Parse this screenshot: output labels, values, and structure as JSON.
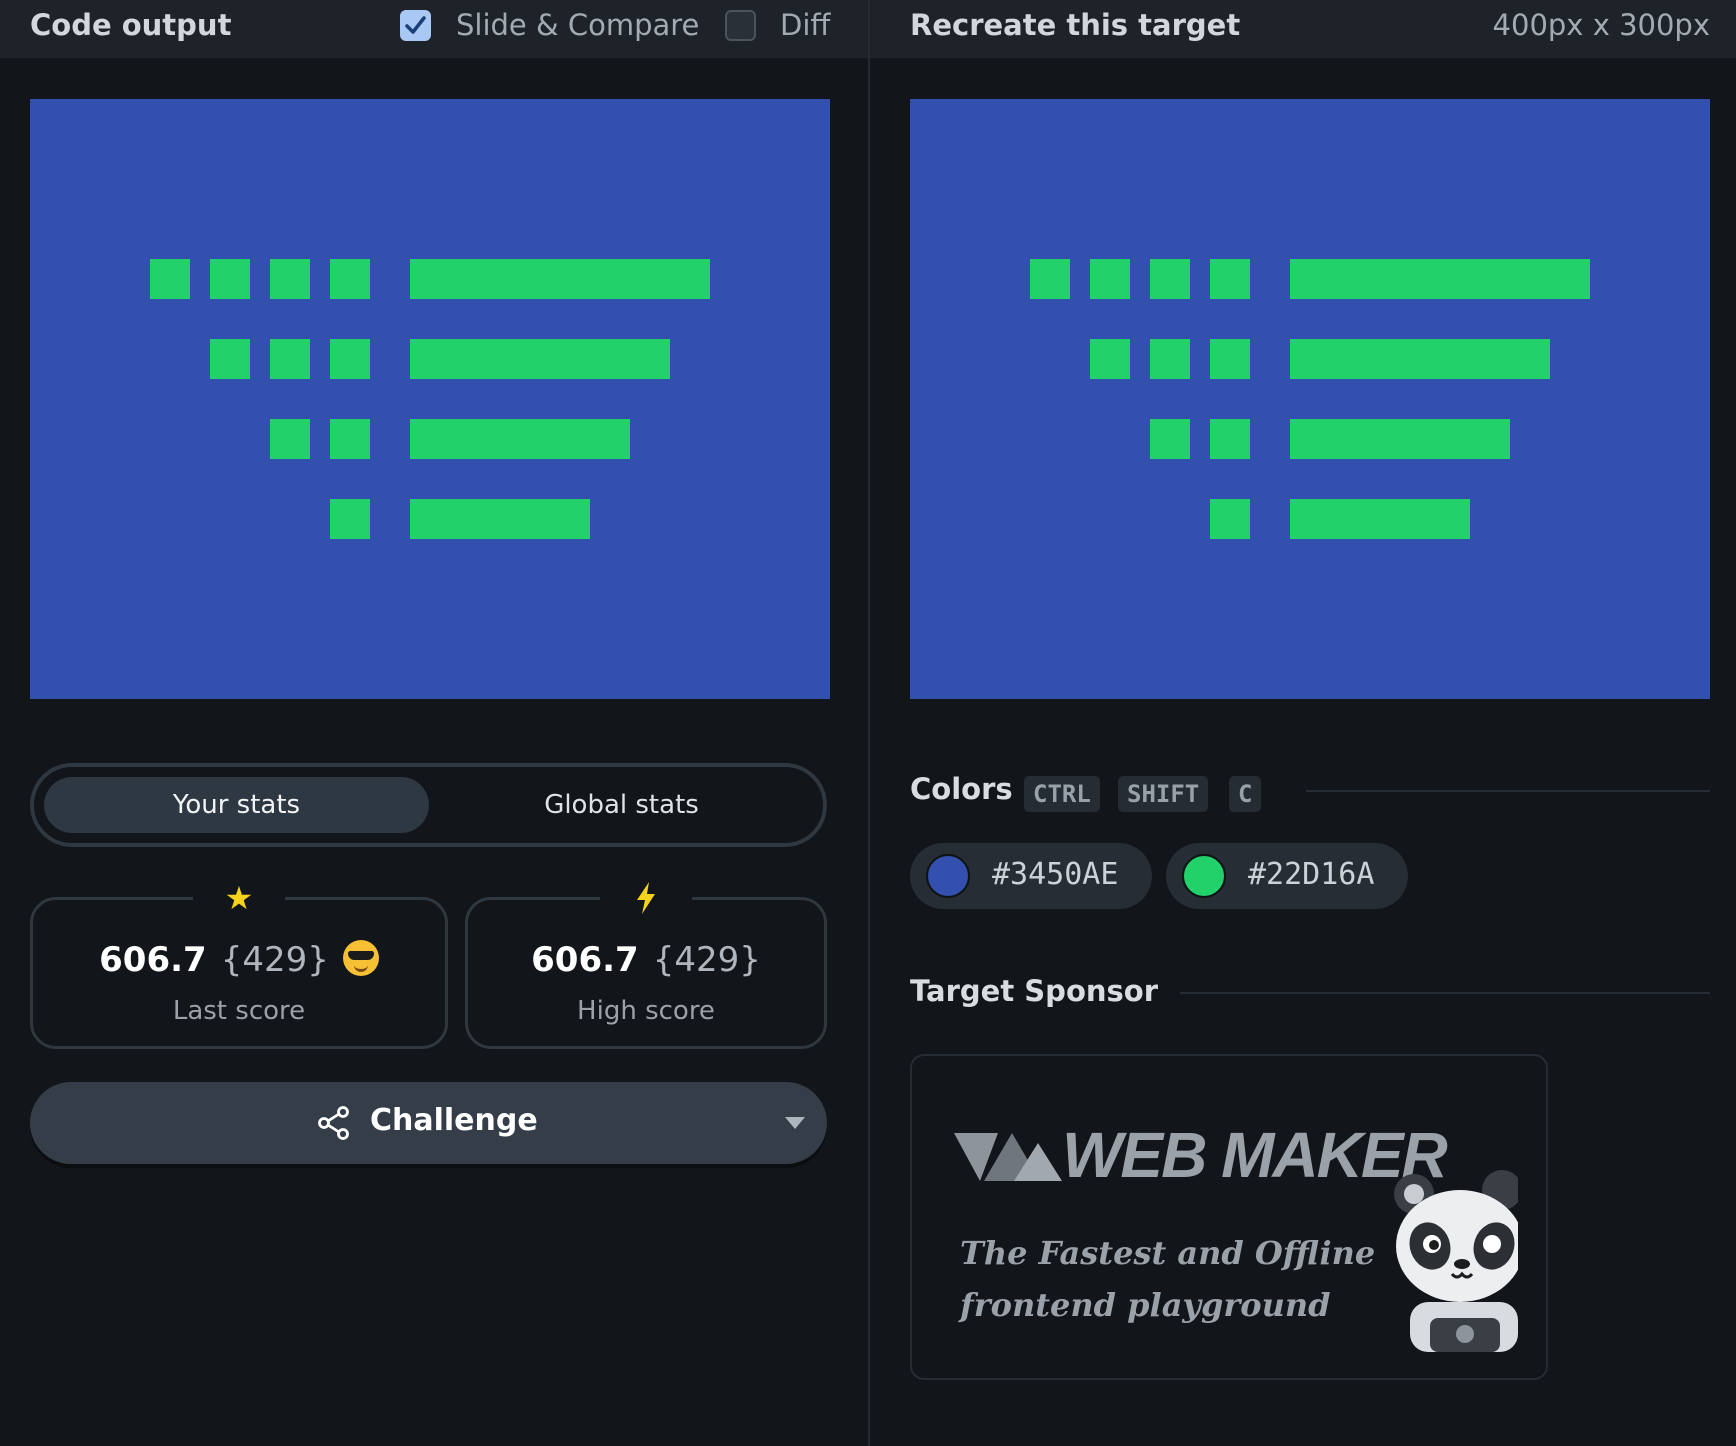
{
  "left_bar": {
    "title": "Code output",
    "slide_compare_label": "Slide & Compare",
    "slide_compare_checked": true,
    "diff_label": "Diff",
    "diff_checked": false
  },
  "right_bar": {
    "title": "Recreate this target",
    "dimensions": "400px x 300px"
  },
  "stats": {
    "tabs": [
      "Your stats",
      "Global stats"
    ],
    "last": {
      "score": "606.7",
      "count": "{429}",
      "label": "Last score"
    },
    "high": {
      "score": "606.7",
      "count": "{429}",
      "label": "High score"
    }
  },
  "challenge_label": "Challenge",
  "colors": {
    "title": "Colors",
    "shortcut": [
      "CTRL",
      "SHIFT",
      "C"
    ],
    "swatches": [
      {
        "hex": "#3450AE"
      },
      {
        "hex": "#22D16A"
      }
    ]
  },
  "sponsor": {
    "title": "Target Sponsor",
    "logo_text": "WEB MAKER",
    "tagline_1": "The Fastest and Offline",
    "tagline_2": "frontend playground"
  }
}
